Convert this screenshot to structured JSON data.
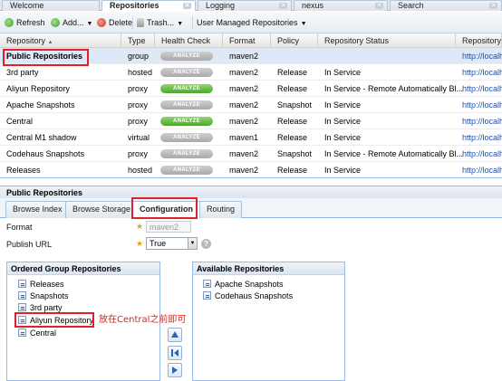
{
  "tabs": [
    {
      "label": "Welcome",
      "active": false
    },
    {
      "label": "Repositories",
      "active": true
    },
    {
      "label": "Logging",
      "active": false
    },
    {
      "label": "nexus",
      "active": false
    },
    {
      "label": "Search",
      "active": false
    }
  ],
  "toolbar": {
    "refresh": "Refresh",
    "add": "Add...",
    "delete": "Delete",
    "trash": "Trash...",
    "user_managed": "User Managed Repositories"
  },
  "grid": {
    "headers": [
      "Repository",
      "Type",
      "Health Check",
      "Format",
      "Policy",
      "Repository Status",
      "Repository P"
    ],
    "analyze_label": "ANALYZE",
    "rows": [
      {
        "name": "Public Repositories",
        "type": "group",
        "health": "grey",
        "format": "maven2",
        "policy": "",
        "status": "",
        "url": "http://localho"
      },
      {
        "name": "3rd party",
        "type": "hosted",
        "health": "grey",
        "format": "maven2",
        "policy": "Release",
        "status": "In Service",
        "url": "http://localho"
      },
      {
        "name": "Aliyun Repository",
        "type": "proxy",
        "health": "green",
        "format": "maven2",
        "policy": "Release",
        "status": "In Service - Remote Automatically Bl...",
        "url": "http://localho"
      },
      {
        "name": "Apache Snapshots",
        "type": "proxy",
        "health": "grey",
        "format": "maven2",
        "policy": "Snapshot",
        "status": "In Service",
        "url": "http://localho"
      },
      {
        "name": "Central",
        "type": "proxy",
        "health": "green",
        "format": "maven2",
        "policy": "Release",
        "status": "In Service",
        "url": "http://localho"
      },
      {
        "name": "Central M1 shadow",
        "type": "virtual",
        "health": "grey",
        "format": "maven1",
        "policy": "Release",
        "status": "In Service",
        "url": "http://localho"
      },
      {
        "name": "Codehaus Snapshots",
        "type": "proxy",
        "health": "grey",
        "format": "maven2",
        "policy": "Snapshot",
        "status": "In Service - Remote Automatically Bl...",
        "url": "http://localho"
      },
      {
        "name": "Releases",
        "type": "hosted",
        "health": "grey",
        "format": "maven2",
        "policy": "Release",
        "status": "In Service",
        "url": "http://localho"
      }
    ]
  },
  "details": {
    "title": "Public Repositories",
    "subtabs": [
      "Browse Index",
      "Browse Storage",
      "Configuration",
      "Routing"
    ],
    "format_label": "Format",
    "format_value": "maven2",
    "publish_label": "Publish URL",
    "publish_value": "True"
  },
  "ordered": {
    "title": "Ordered Group Repositories",
    "items": [
      "Releases",
      "Snapshots",
      "3rd party",
      "Aliyun Repository",
      "Central"
    ]
  },
  "available": {
    "title": "Available Repositories",
    "items": [
      "Apache Snapshots",
      "Codehaus Snapshots"
    ]
  },
  "annotation": "放在Central之前即可",
  "colors": {
    "highlight": "#e0202a",
    "accent": "#99bbe8",
    "analyze_green": "#4ea52f"
  }
}
